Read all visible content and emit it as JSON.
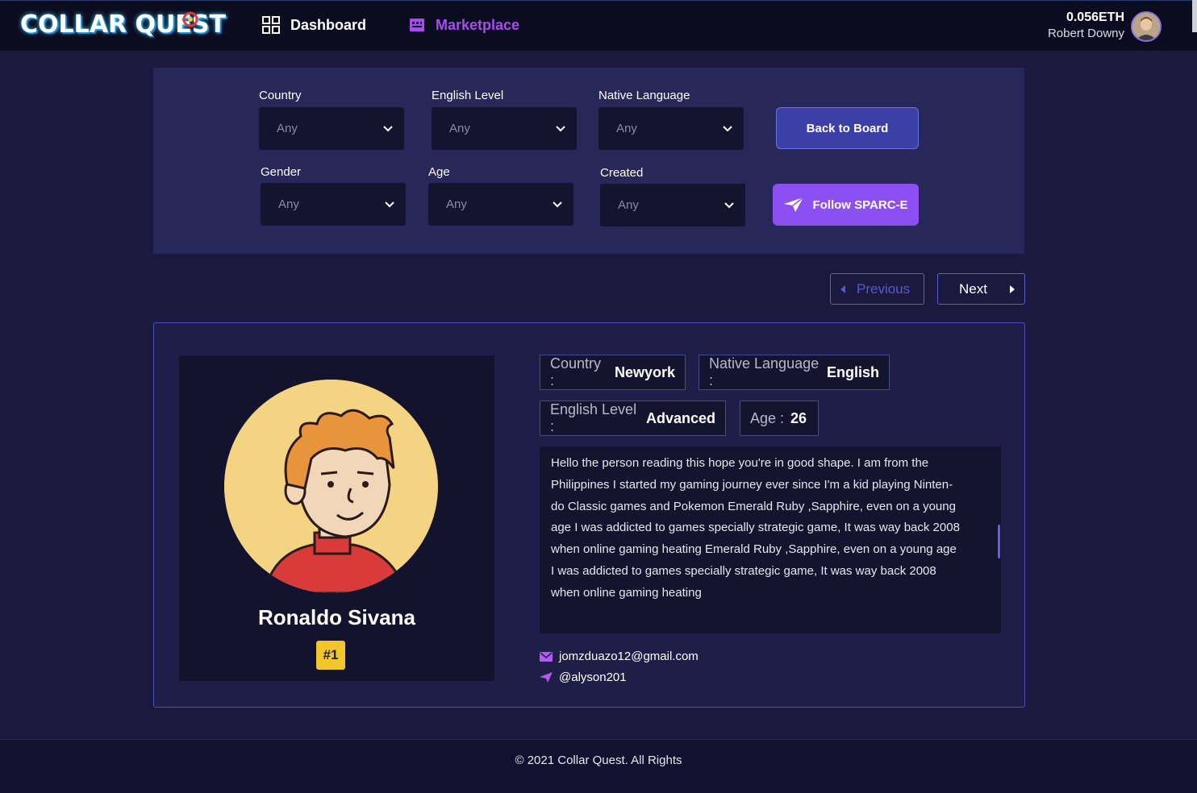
{
  "header": {
    "logo_text": "COLLAR QUEST",
    "nav": [
      {
        "label": "Dashboard",
        "icon": "grid-icon"
      },
      {
        "label": "Marketplace",
        "icon": "store-icon"
      }
    ],
    "account": {
      "balance": "0.056ETH",
      "name": "Robert Downy"
    }
  },
  "filters": {
    "country": {
      "label": "Country",
      "value": "Any"
    },
    "english_level": {
      "label": "English Level",
      "value": "Any"
    },
    "native_language": {
      "label": "Native Language",
      "value": "Any"
    },
    "gender": {
      "label": "Gender",
      "value": "Any"
    },
    "age": {
      "label": "Age",
      "value": "Any"
    },
    "created": {
      "label": "Created",
      "value": "Any"
    },
    "back_button": "Back to Board",
    "follow_button": "Follow SPARC-E"
  },
  "pager": {
    "previous": "Previous",
    "next": "Next"
  },
  "profile": {
    "name": "Ronaldo Sivana",
    "rank": "#1",
    "country": {
      "key": "Country :",
      "value": "Newyork"
    },
    "native_language": {
      "key": "Native Language :",
      "value": "English"
    },
    "english_level": {
      "key": "English Level :",
      "value": "Advanced"
    },
    "age": {
      "key": "Age :",
      "value": "26"
    },
    "bio_lines": [
      "Hello the person reading this hope you're in good shape. I am from the",
      "Philippines I started my gaming journey ever since I'm a kid playing Ninten-",
      "do Classic games and Pokemon Emerald Ruby ,Sapphire, even on a young",
      "age I was addicted to games specially strategic game, It was way back 2008",
      "when online gaming heating Emerald Ruby ,Sapphire, even on a young age",
      "I was addicted to games specially strategic game, It was way back 2008",
      "when online gaming heating"
    ],
    "email": "jomzduazo12@gmail.com",
    "telegram": "@alyson201"
  },
  "footer": {
    "text": "© 2021  Collar Quest. All Rights"
  },
  "colors": {
    "accent": "#8b4ff2",
    "marketplace": "#a84cf0",
    "rank": "#f2c52b"
  }
}
